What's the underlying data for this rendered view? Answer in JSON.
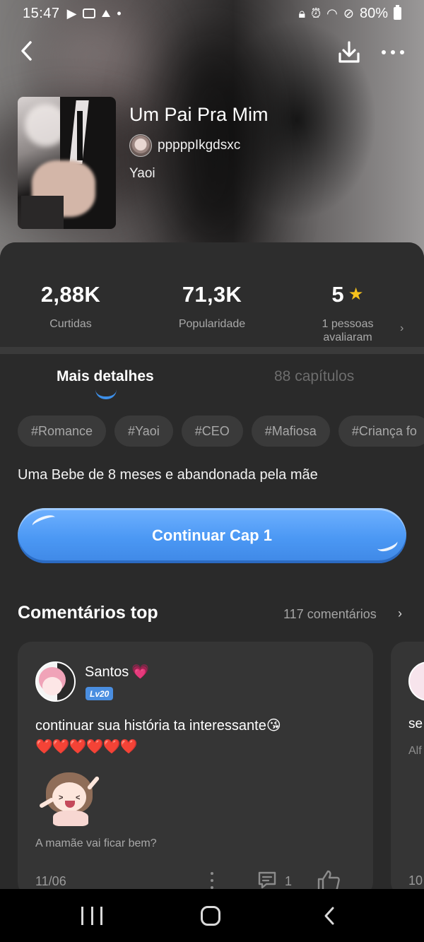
{
  "status_bar": {
    "time": "15:47",
    "battery": "80%",
    "left_icons": [
      "youtube-icon",
      "instagram-icon",
      "gallery-icon",
      "dot-icon"
    ],
    "right_icons": [
      "lock-icon",
      "alarm-icon",
      "wifi-icon",
      "block-icon",
      "battery-icon"
    ]
  },
  "header": {
    "back_icon": "chevron-left-icon",
    "download_icon": "download-icon",
    "more_icon": "more-horizontal-icon"
  },
  "book": {
    "title": "Um Pai Pra Mim",
    "author": "pppppIkgdsxc",
    "genre": "Yaoi"
  },
  "stats": {
    "likes_value": "2,88K",
    "likes_label": "Curtidas",
    "popularity_value": "71,3K",
    "popularity_label": "Popularidade",
    "rating_value": "5",
    "rating_label": "1 pessoas avaliaram"
  },
  "tabs": {
    "details": "Mais detalhes",
    "chapters": "88 capítulos"
  },
  "tags": [
    "#Romance",
    "#Yaoi",
    "#CEO",
    "#Mafiosa",
    "#Criança fo"
  ],
  "description": "Uma Bebe de 8 meses  e abandonada pela mãe",
  "cta": {
    "label": "Continuar Cap 1"
  },
  "comments": {
    "heading": "Comentários top",
    "count_label": "117 comentários",
    "items": [
      {
        "user": "Santos",
        "level": "Lv20",
        "text": "continuar sua história ta interessante😘",
        "hearts": "❤️❤️❤️❤️❤️❤️",
        "reply_preview": "A mamãe vai ficar bem?",
        "date": "11/06",
        "reply_count": "1"
      },
      {
        "text_partial": "se",
        "sub_partial": "Alf",
        "date_partial": "10"
      }
    ]
  },
  "colors": {
    "accent": "#4b98f4",
    "sheet_bg": "#2a2a2a",
    "star": "#f6c21c",
    "level_badge": "#4a8ee0"
  }
}
